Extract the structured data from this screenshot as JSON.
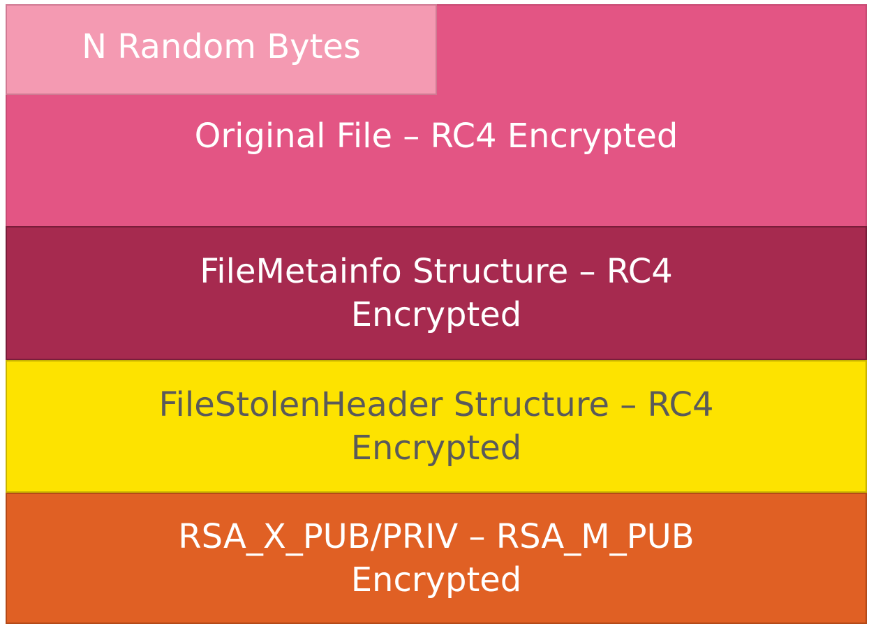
{
  "blocks": {
    "random_bytes": {
      "label": "N Random Bytes",
      "color": "#f49ab2"
    },
    "original_file": {
      "label": "Original File – RC4 Encrypted",
      "color": "#e35584"
    },
    "file_metainfo": {
      "label": "FileMetainfo Structure – RC4\nEncrypted",
      "color": "#a62a4f"
    },
    "file_stolen_header": {
      "label": "FileStolenHeader Structure – RC4\nEncrypted",
      "color": "#fde300"
    },
    "rsa_keys": {
      "label": "RSA_X_PUB/PRIV – RSA_M_PUB\nEncrypted",
      "color": "#e06024"
    }
  }
}
